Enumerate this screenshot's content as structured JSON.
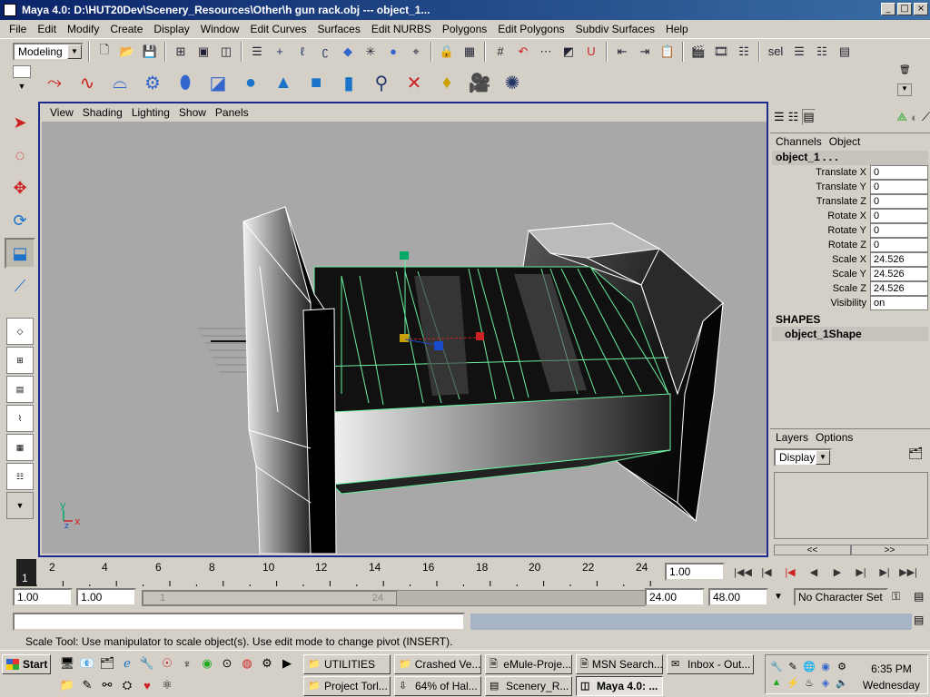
{
  "window": {
    "title": "Maya 4.0: D:\\HUT20Dev\\Scenery_Resources\\Other\\h gun rack.obj   ---   object_1...",
    "minimize": "_",
    "maximize": "□",
    "close": "×"
  },
  "menu": [
    "File",
    "Edit",
    "Modify",
    "Create",
    "Display",
    "Window",
    "Edit Curves",
    "Surfaces",
    "Edit NURBS",
    "Polygons",
    "Edit Polygons",
    "Subdiv Surfaces",
    "Help"
  ],
  "statusline": {
    "mode": "Modeling",
    "sel_label": "sel"
  },
  "panel": {
    "menu": [
      "View",
      "Shading",
      "Lighting",
      "Show",
      "Panels"
    ],
    "camera": "persp"
  },
  "channel_box": {
    "tabs": [
      "Channels",
      "Object"
    ],
    "object_name": "object_1 . . .",
    "attributes": [
      {
        "label": "Translate X",
        "value": "0"
      },
      {
        "label": "Translate Y",
        "value": "0"
      },
      {
        "label": "Translate Z",
        "value": "0"
      },
      {
        "label": "Rotate X",
        "value": "0"
      },
      {
        "label": "Rotate Y",
        "value": "0"
      },
      {
        "label": "Rotate Z",
        "value": "0"
      },
      {
        "label": "Scale X",
        "value": "24.526"
      },
      {
        "label": "Scale Y",
        "value": "24.526"
      },
      {
        "label": "Scale Z",
        "value": "24.526"
      },
      {
        "label": "Visibility",
        "value": "on"
      }
    ],
    "shapes_header": "SHAPES",
    "shape_name": "object_1Shape"
  },
  "layers": {
    "tabs": [
      "Layers",
      "Options"
    ],
    "dropdown": "Display",
    "nav_left": "<<",
    "nav_right": ">>"
  },
  "timeslider": {
    "ticks": [
      "2",
      "4",
      "6",
      "8",
      "10",
      "12",
      "14",
      "16",
      "18",
      "20",
      "22",
      "24"
    ],
    "current_marker": "1",
    "current_frame": "1.00"
  },
  "range": {
    "start_min": "1.00",
    "start": "1.00",
    "thumb_left": "1",
    "thumb_right": "24",
    "end": "24.00",
    "end_max": "48.00",
    "character_set": "No Character Set"
  },
  "helpline": "Scale Tool: Use manipulator to scale object(s). Use edit mode to change pivot (INSERT).",
  "taskbar": {
    "start": "Start",
    "tasks_row1": [
      "UTILITIES",
      "Crashed Ve...",
      "eMule-Proje...",
      "MSN Search...",
      "Inbox - Out..."
    ],
    "tasks_row2": [
      "Project Torl...",
      "64% of Hal...",
      "Scenery_R...",
      "Maya 4.0: ..."
    ],
    "clock_time": "6:35 PM",
    "clock_day": "Wednesday"
  },
  "colors": {
    "title_start": "#0a246a",
    "title_end": "#3a6ea5",
    "viewport_bg": "#a8a8a8",
    "wire_selected": "#6bf0a0",
    "panel_border": "#1c2a8c"
  }
}
